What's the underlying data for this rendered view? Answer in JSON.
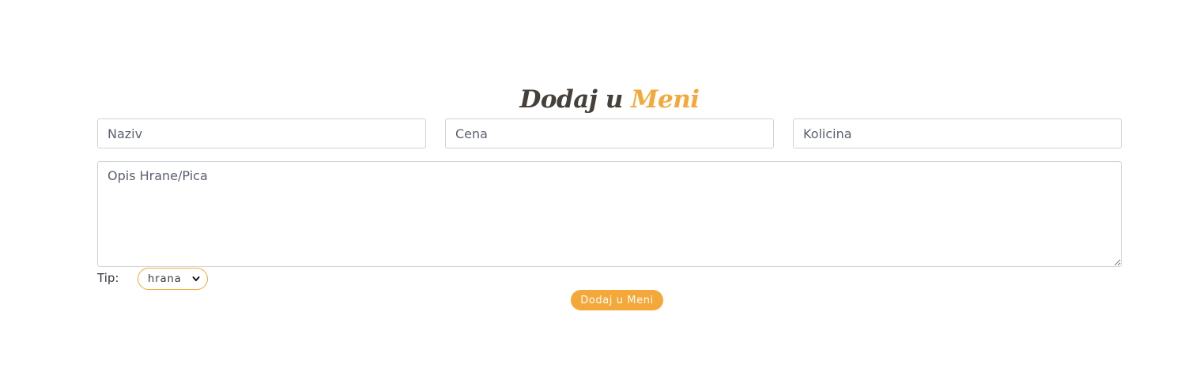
{
  "heading": {
    "part1": "Dodaj u",
    "part2": "Meni"
  },
  "form": {
    "naziv_placeholder": "Naziv",
    "cena_placeholder": "Cena",
    "kolicina_placeholder": "Kolicina",
    "opis_placeholder": "Opis Hrane/Pica",
    "tip_label": "Tip:",
    "tip_selected": "hrana",
    "submit_label": "Dodaj u Meni"
  },
  "colors": {
    "accent": "#f5a83a",
    "heading_dark": "#45403a",
    "input_border": "#cfd2d6"
  }
}
